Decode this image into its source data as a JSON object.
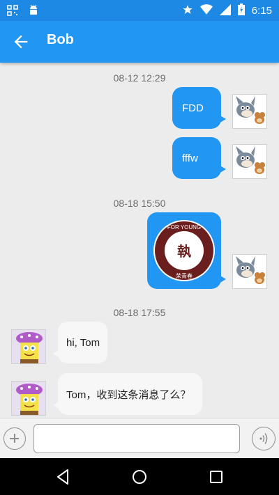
{
  "status_bar": {
    "time": "6:15",
    "icons": [
      "notification-icon",
      "android-icon",
      "star-icon",
      "wifi-icon",
      "signal-icon",
      "battery-icon"
    ]
  },
  "app_bar": {
    "title": "Bob",
    "back_icon": "arrow-back-icon"
  },
  "messages": [
    {
      "type": "timestamp",
      "text": "08-12 12:29"
    },
    {
      "type": "outgoing",
      "text": "FDD"
    },
    {
      "type": "outgoing",
      "text": "fffw"
    },
    {
      "type": "timestamp",
      "text": "08-18 15:50"
    },
    {
      "type": "outgoing-image",
      "image_text": "FOR YOUNG",
      "image_subtext": "荣青春"
    },
    {
      "type": "timestamp",
      "text": "08-18 17:55"
    },
    {
      "type": "incoming",
      "text": "hi, Tom"
    },
    {
      "type": "incoming",
      "text": "Tom，收到这条消息了么？"
    }
  ],
  "input_bar": {
    "value": "",
    "placeholder": "",
    "add_icon": "plus-circle-icon",
    "voice_icon": "voice-icon"
  },
  "nav_bar": {
    "icons": [
      "back-triangle-icon",
      "home-circle-icon",
      "recents-square-icon"
    ]
  },
  "colors": {
    "status_bar": "#1e88e5",
    "app_bar": "#2196f3",
    "bubble_out": "#2196f3",
    "bubble_in": "#f7f7f7",
    "background": "#ececec"
  }
}
